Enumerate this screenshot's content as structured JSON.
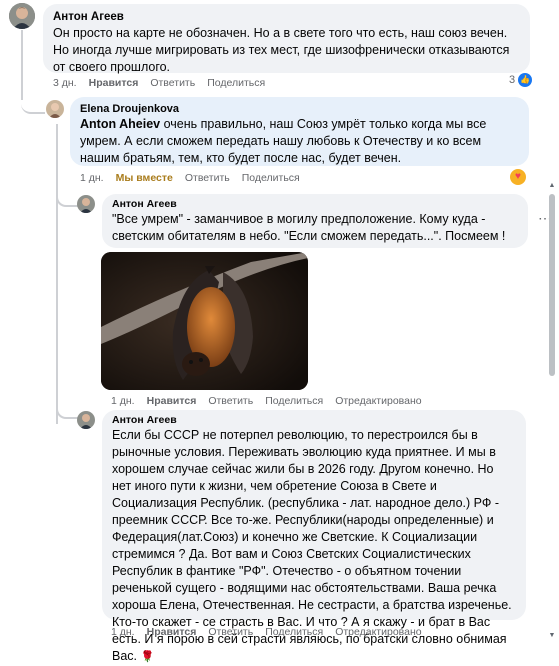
{
  "comments": [
    {
      "author": "Антон Агеев",
      "text": "Он просто на карте не обозначен. Но а в свете того что есть, наш союз вечен. Но иногда лучше мигрировать из тех мест, где шизофренически отказываются от своего прошлого.",
      "time": "3 дн.",
      "like": "Нравится",
      "reply": "Ответить",
      "share": "Поделиться",
      "reaction_count": "3"
    },
    {
      "author": "Elena Droujenkova",
      "mention": "Anton Aheiev",
      "text": " очень правильно, наш Союз умрёт только когда мы все умрем. А если сможем передать нашу любовь к Отечеству и ко всем нашим братьям, тем, кто будет после нас, будет вечен.",
      "time": "1 дн.",
      "like": "Мы вместе",
      "reply": "Ответить",
      "share": "Поделиться"
    },
    {
      "author": "Антон Агеев",
      "text": "\"Все умрем\" - заманчивое в могилу предположение. Кому куда - светским обитателям в небо. \"Если сможем передать...\". Посмеем !",
      "time": "1 дн.",
      "like": "Нравится",
      "reply": "Ответить",
      "share": "Поделиться",
      "edited": "Отредактировано"
    },
    {
      "author": "Антон Агеев",
      "text": "Если бы СССР не потерпел революцию, то перестроился бы в рыночные условия. Переживать эволюцию куда приятнее. И мы в хорошем случае сейчас жили бы в 2026 году. Другом конечно. Но нет иного пути к жизни, чем обретение Союза в Свете и Социализация Республик. (республика - лат. народное дело.) РФ - преемник СССР. Все то-же. Республики(народы определенные) и Федерация(лат.Союз) и конечно же Светские. К Социализации стремимся ? Да. Вот вам и Союз Светских Социалистических Республик в фантике \"РФ\". Отечество - о объятном точении реченькой сущего - водящими нас обстоятельствами. Ваша речка хороша Елена, Отечественная. Не сестрасти, а братства изреченье. Кто-то скажет - се страсть в Вас. И что ? А я скажу - и брат в Вас есть. И я порою в сей страсти являюсь, по братски словно обнимая Вас.",
      "time": "1 дн.",
      "like": "Нравится",
      "reply": "Ответить",
      "share": "Поделиться",
      "edited": "Отредактировано"
    }
  ],
  "icons": {
    "more": "⋯",
    "rose": "🌹"
  },
  "colors": {
    "highlight_bubble": "#e7f0fa",
    "bubble": "#f0f2f5",
    "reaction_like": "#1877f2",
    "reaction_love": "#f33e58",
    "together": "#a97c1c"
  }
}
